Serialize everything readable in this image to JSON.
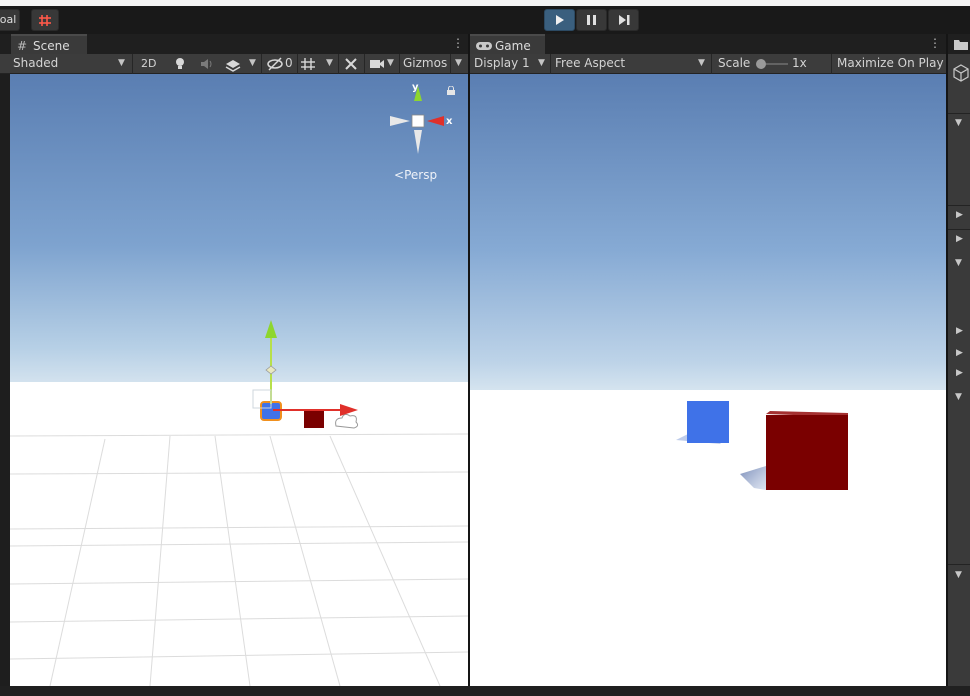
{
  "toolbar_main": {
    "left_label": "oal",
    "play_icon": "play-icon",
    "pause_icon": "pause-icon",
    "step_icon": "step-icon"
  },
  "scene": {
    "tab_label": "Scene",
    "shading_mode": "Shaded",
    "mode_2d": "2D",
    "hidden_count": "0",
    "gizmos_label": "Gizmos",
    "persp_label": "Persp",
    "axis_y": "y",
    "axis_x": "x"
  },
  "game": {
    "tab_label": "Game",
    "display": "Display 1",
    "aspect": "Free Aspect",
    "scale_label": "Scale",
    "scale_value": "1x",
    "maximize_label": "Maximize On Play"
  },
  "colors": {
    "sky_top": "#5a7eb2",
    "sky_horizon": "#c9dcec",
    "ground": "#ffffff",
    "blue_cube": "#3f72e8",
    "red_cube": "#7a0000",
    "gizmo_x": "#e0302a",
    "gizmo_y": "#8ed62e"
  }
}
